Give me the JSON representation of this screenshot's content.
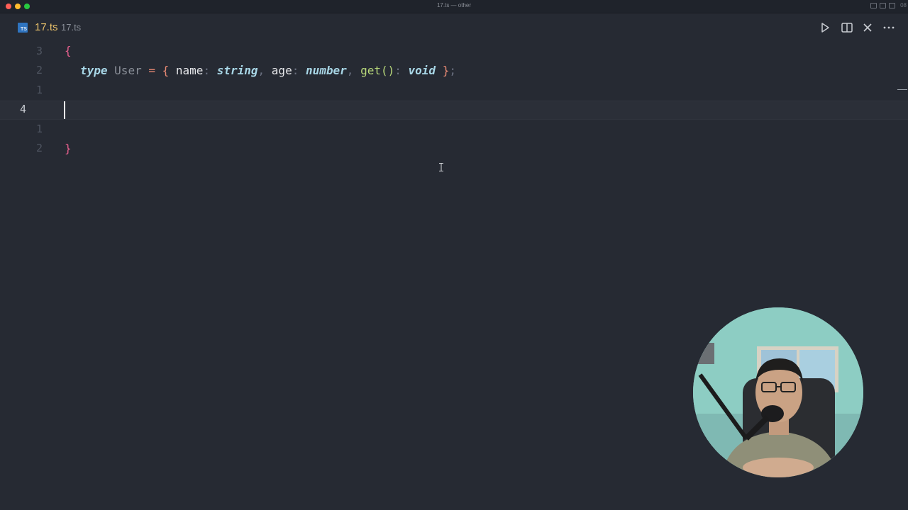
{
  "window": {
    "title": "17.ts — other",
    "clock": "08"
  },
  "tab": {
    "icon_label": "TS",
    "file_name": "17.ts",
    "path": "17.ts"
  },
  "toolbar": {
    "icons": [
      "run-icon",
      "split-editor-icon",
      "close-icon",
      "more-icon"
    ]
  },
  "editor": {
    "line_numbers": [
      "3",
      "2",
      "1",
      "4",
      "1",
      "2"
    ],
    "code": {
      "line1_open_brace": "{",
      "line2": {
        "kw_type": "type",
        "type_name": "User",
        "eq": "=",
        "open": "{",
        "p1": "name",
        "t1": "string",
        "p2": "age",
        "t2": "number",
        "p3": "get()",
        "t3": "void",
        "close": "}",
        "semi": ";"
      },
      "line6_close_brace": "}"
    }
  },
  "colors": {
    "background": "#262a33",
    "keyword": "#a9d8e9",
    "brace": "#e45f8d",
    "function": "#b7d77a",
    "tab_active": "#e8c06a"
  }
}
